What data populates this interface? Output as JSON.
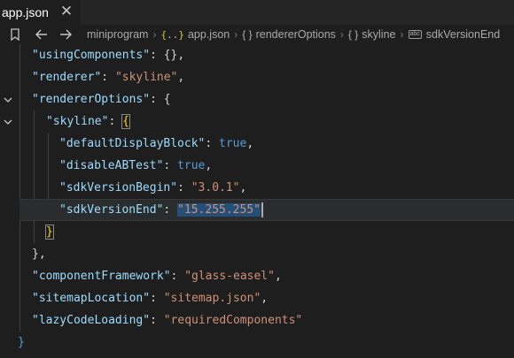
{
  "tab": {
    "label": "app.json",
    "close": "✕"
  },
  "breadcrumb": {
    "items": [
      "miniprogram",
      "app.json",
      "rendererOptions",
      "skyline",
      "sdkVersionEnd"
    ],
    "json_icon": "{..}",
    "obj_icon": "{ }",
    "abc_icon": "abc"
  },
  "editor": {
    "lines": [
      {
        "key": "\"usingComponents\"",
        "value": "{}",
        "trail": ","
      },
      {
        "key": "\"renderer\"",
        "value": "\"skyline\"",
        "trail": ","
      },
      {
        "key": "\"rendererOptions\"",
        "value": "{"
      },
      {
        "key": "\"skyline\"",
        "value": "{"
      },
      {
        "key": "\"defaultDisplayBlock\"",
        "value": "true",
        "trail": ","
      },
      {
        "key": "\"disableABTest\"",
        "value": "true",
        "trail": ","
      },
      {
        "key": "\"sdkVersionBegin\"",
        "value": "\"3.0.1\"",
        "trail": ","
      },
      {
        "key": "\"sdkVersionEnd\"",
        "value": "\"15.255.255\""
      },
      {
        "text": "}"
      },
      {
        "text": "},"
      },
      {
        "key": "\"componentFramework\"",
        "value": "\"glass-easel\"",
        "trail": ","
      },
      {
        "key": "\"sitemapLocation\"",
        "value": "\"sitemap.json\"",
        "trail": ","
      },
      {
        "key": "\"lazyCodeLoading\"",
        "value": "\"requiredComponents\""
      },
      {
        "text": "}"
      }
    ]
  },
  "colors": {
    "background": "#1e1e1e",
    "key": "#9cdcfe",
    "string": "#ce9178",
    "boolean": "#569cd6",
    "bracket": "#ffd700",
    "selection": "#264f78"
  },
  "icons": [
    "close-icon",
    "bookmark-icon",
    "back-arrow-icon",
    "forward-arrow-icon",
    "fold-chevron-icon"
  ]
}
